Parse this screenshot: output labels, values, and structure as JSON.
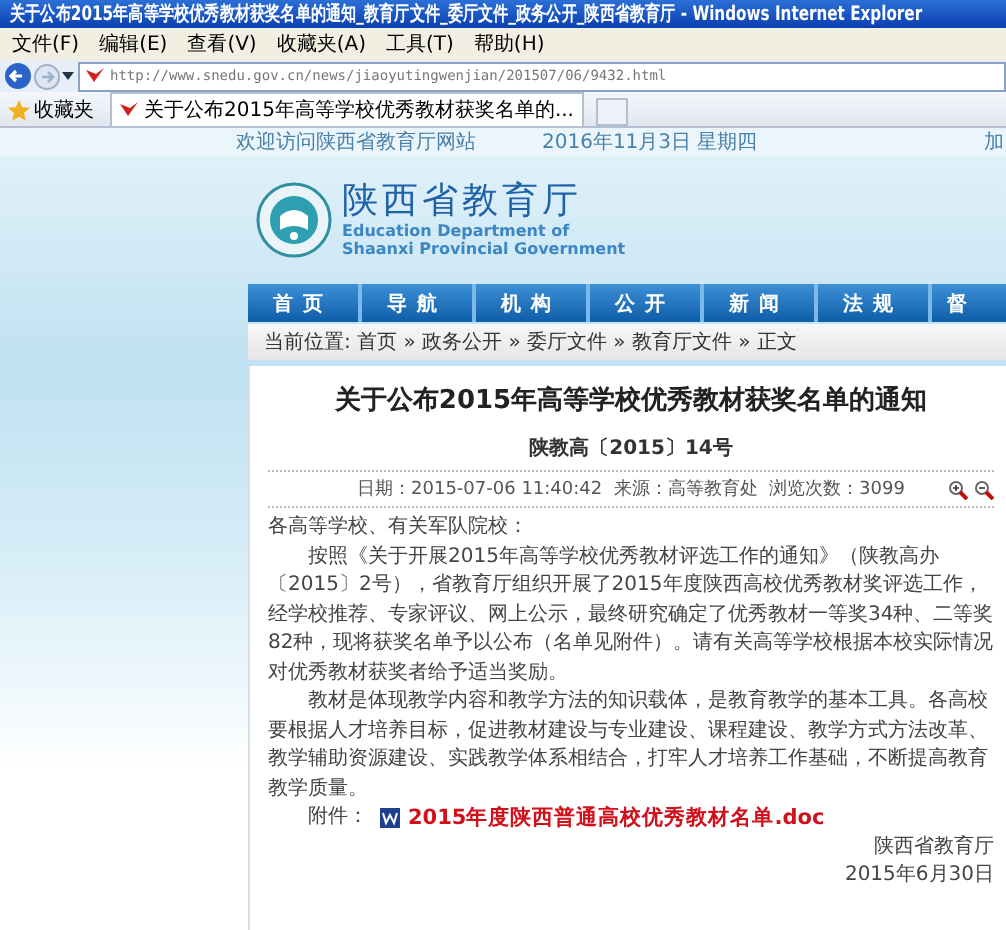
{
  "window": {
    "title": "关于公布2015年高等学校优秀教材获奖名单的通知_教育厅文件_委厅文件_政务公开_陕西省教育厅 - Windows Internet Explorer"
  },
  "menu": [
    "文件(F)",
    "编辑(E)",
    "查看(V)",
    "收藏夹(A)",
    "工具(T)",
    "帮助(H)"
  ],
  "address_bar": {
    "url": "http://www.snedu.gov.cn/news/jiaoyutingwenjian/201507/06/9432.html"
  },
  "favorites_bar": {
    "label": "收藏夹",
    "tab": "关于公布2015年高等学校优秀教材获奖名单的..."
  },
  "site": {
    "welcome": "欢迎访问陕西省教育厅网站",
    "date": "2016年11月3日 星期四",
    "top_link": "加",
    "logo_title": "陕西省教育厅",
    "logo_subtitle": [
      "Education Department of",
      "Shaanxi Provincial Government"
    ]
  },
  "nav": [
    "首页",
    "导航",
    "机构",
    "公开",
    "新闻",
    "法规",
    "督"
  ],
  "breadcrumb": "当前位置: 首页 » 政务公开 » 委厅文件 » 教育厅文件 » 正文",
  "article": {
    "title": "关于公布2015年高等学校优秀教材获奖名单的通知",
    "doc_number": "陕教高〔2015〕14号",
    "meta": "日期：2015-07-06 11:40:42  来源：高等教育处  浏览次数：3099",
    "salutation": "各高等学校、有关军队院校：",
    "paragraphs": [
      "按照《关于开展2015年高等学校优秀教材评选工作的通知》（陕教高办〔2015〕2号），省教育厅组织开展了2015年度陕西高校优秀教材奖评选工作，经学校推荐、专家评议、网上公示，最终研究确定了优秀教材一等奖34种、二等奖82种，现将获奖名单予以公布（名单见附件）。请有关高等学校根据本校实际情况对优秀教材获奖者给予适当奖励。",
      "教材是体现教学内容和教学方法的知识载体，是教育教学的基本工具。各高校要根据人才培养目标，促进教材建设与专业建设、课程建设、教学方式方法改革、教学辅助资源建设、实践教学体系相结合，打牢人才培养工作基础，不断提高教育教学质量。"
    ],
    "attachment": {
      "label": "附件：",
      "file": "2015年度陕西普通高校优秀教材名单.doc"
    },
    "signature": "陕西省教育厅",
    "date": "2015年6月30日"
  }
}
